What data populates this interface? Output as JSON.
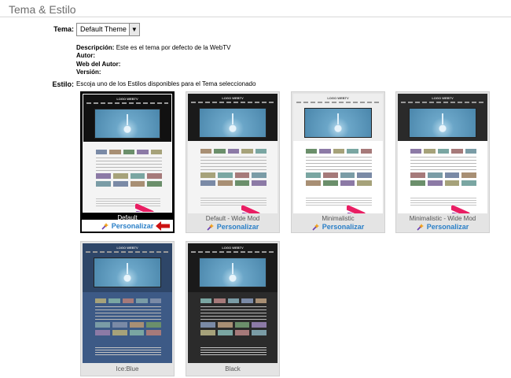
{
  "section": {
    "title": "Tema & Estilo"
  },
  "tema": {
    "label": "Tema:",
    "selected": "Default Theme",
    "description_label": "Descripción:",
    "description_value": "Este es el tema por defecto de la WebTV",
    "author_label": "Autor:",
    "author_web_label": "Web del Autor:",
    "version_label": "Versión:"
  },
  "estilo": {
    "label": "Estilo:",
    "description": "Escoja uno de los Estilos disponibles para el Tema seleccionado",
    "customize_label": "Personalizar",
    "styles": [
      {
        "name": "Default",
        "selected": true,
        "dark": false,
        "header_color": "#111111",
        "body_color": "#f4f4f4"
      },
      {
        "name": "Default - Wide Mod",
        "selected": false,
        "dark": false,
        "header_color": "#1a1a1a",
        "body_color": "#f4f4f4"
      },
      {
        "name": "Minimalistic",
        "selected": false,
        "dark": false,
        "header_color": "#eeeeee",
        "body_color": "#ffffff"
      },
      {
        "name": "Minimalistic - Wide Mod",
        "selected": false,
        "dark": false,
        "header_color": "#2a2a2a",
        "body_color": "#ffffff"
      },
      {
        "name": "Ice:Blue",
        "selected": false,
        "dark": true,
        "header_color": "#2e4668",
        "body_color": "#3d5a86"
      },
      {
        "name": "Black",
        "selected": false,
        "dark": true,
        "header_color": "#1a1a1a",
        "body_color": "#2b2b2b"
      }
    ]
  },
  "mini_logo": "LOGO WEBTV",
  "colors": {
    "link_blue": "#2a7fc7",
    "selected_border": "#000000",
    "arrow_red": "#cc1111"
  }
}
